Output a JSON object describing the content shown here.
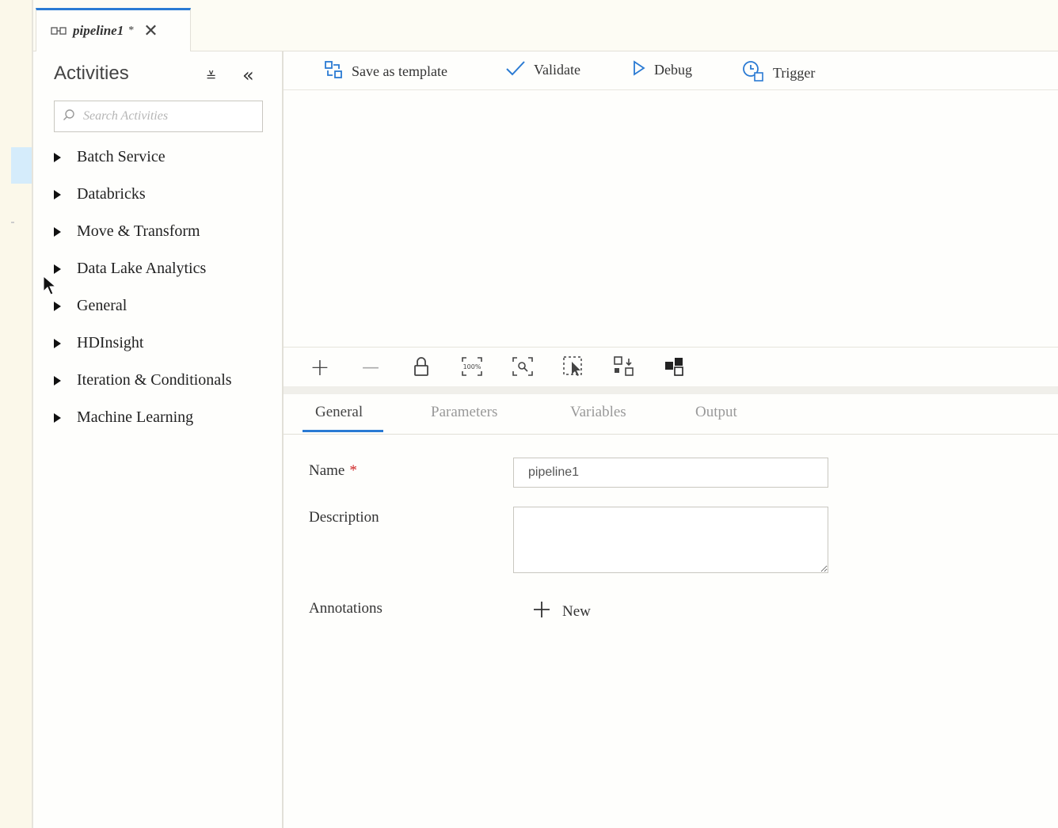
{
  "tab": {
    "title": "pipeline1",
    "dirty_marker": "*",
    "close_glyph": "✕"
  },
  "activities": {
    "header": "Activities",
    "collapse_glyph": "≚",
    "hide_glyph": "«",
    "search_placeholder": "Search Activities",
    "categories": [
      "Batch Service",
      "Databricks",
      "Move & Transform",
      "Data Lake Analytics",
      "General",
      "HDInsight",
      "Iteration & Conditionals",
      "Machine Learning"
    ]
  },
  "toolbar": {
    "save_template": "Save as template",
    "validate": "Validate",
    "debug": "Debug",
    "trigger": "Trigger"
  },
  "canvas_tools": {
    "zoom_in": "+",
    "zoom_out": "—"
  },
  "props": {
    "tabs": [
      "General",
      "Parameters",
      "Variables",
      "Output"
    ],
    "active_tab": "General",
    "name_label": "Name",
    "required_marker": "*",
    "name_value": "pipeline1",
    "description_label": "Description",
    "description_value": "",
    "annotations_label": "Annotations",
    "new_label": "New"
  },
  "colors": {
    "accent": "#2a7ad3",
    "required": "#d02828",
    "sidebar_highlight": "#d5ecfb"
  }
}
